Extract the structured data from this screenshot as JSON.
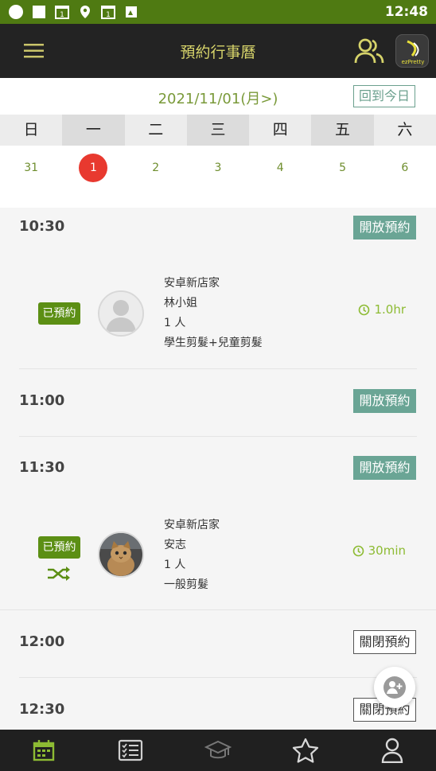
{
  "status_bar": {
    "time": "12:48",
    "icons": [
      "circle-app-icon",
      "square-app-icon",
      "calendar-1-icon",
      "location-pin-icon",
      "calendar-1-icon",
      "photo-icon"
    ]
  },
  "app_bar": {
    "title": "預約行事曆",
    "menu_icon": "hamburger-menu-icon",
    "users_icon": "users-icon",
    "brand_logo": "ezPretty"
  },
  "date_header": {
    "label": "2021/11/01(月>)",
    "today_button": "回到今日"
  },
  "weekdays": [
    "日",
    "一",
    "二",
    "三",
    "四",
    "五",
    "六"
  ],
  "days": [
    {
      "num": "31",
      "selected": false
    },
    {
      "num": "1",
      "selected": true
    },
    {
      "num": "2",
      "selected": false
    },
    {
      "num": "3",
      "selected": false
    },
    {
      "num": "4",
      "selected": false
    },
    {
      "num": "5",
      "selected": false
    },
    {
      "num": "6",
      "selected": false
    }
  ],
  "slots": [
    {
      "time": "10:30",
      "button": "開放預約",
      "state": "open"
    },
    {
      "time": "11:00",
      "button": "開放預約",
      "state": "open"
    },
    {
      "time": "11:30",
      "button": "開放預約",
      "state": "open"
    },
    {
      "time": "12:00",
      "button": "關閉預約",
      "state": "closed"
    },
    {
      "time": "12:30",
      "button": "關閉預約",
      "state": "closed"
    }
  ],
  "bookings": [
    {
      "badge": "已預約",
      "store": "安卓新店家",
      "customer": "林小姐",
      "people": "1 人",
      "service": "學生剪髮+兒童剪髮",
      "duration": "1.0hr",
      "avatar": "default-person"
    },
    {
      "badge": "已預約",
      "store": "安卓新店家",
      "customer": "安志",
      "people": "1 人",
      "service": "一般剪髮",
      "duration": "30min",
      "avatar": "cat-photo"
    }
  ],
  "bottom_nav": [
    "calendar-icon",
    "checklist-icon",
    "graduation-cap-icon",
    "star-icon",
    "profile-icon"
  ],
  "colors": {
    "status_bar": "#4f7a12",
    "app_bar": "#232323",
    "title": "#d6d36a",
    "accent_green": "#5c8f14",
    "open_button": "#6aa595",
    "selected_day": "#e8392f"
  }
}
